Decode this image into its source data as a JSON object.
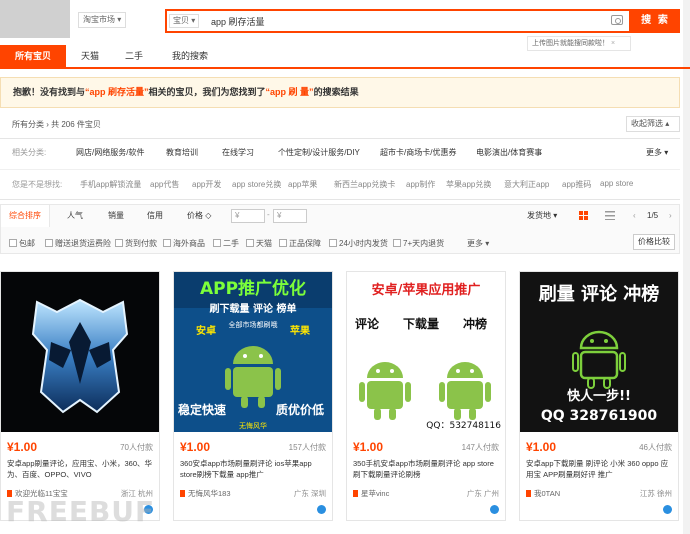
{
  "header": {
    "market_label": "淘宝市场",
    "search_category": "宝贝",
    "search_query": "app 刷存活量",
    "search_button": "搜 索",
    "upload_tip": "上传图片就能搜同款啦！"
  },
  "tabs": [
    {
      "label": "所有宝贝"
    },
    {
      "label": "天猫"
    },
    {
      "label": "二手"
    },
    {
      "label": "我的搜索"
    }
  ],
  "notice": {
    "prefix": "抱歉！没有找到与",
    "query1": "“app 刷存活量”",
    "mid": "相关的宝贝，我们为您找到了",
    "query2": "“app 刷 量”",
    "suffix": "的搜索结果"
  },
  "breadcrumb": {
    "text": "所有分类 › 共 206 件宝贝",
    "filter_toggle": "收起筛选"
  },
  "related_categories": {
    "label": "相关分类:",
    "items": [
      "网店/网络服务/软件",
      "教育培训",
      "在线学习",
      "个性定制/设计服务/DIY",
      "超市卡/商场卡/优惠券",
      "电影演出/体育赛事"
    ],
    "more": "更多"
  },
  "related_search": {
    "label": "您是不是想找:",
    "items": [
      "手机app解锁流量",
      "app代售",
      "app开发",
      "app store兑换",
      "app苹果",
      "新西兰app兑换卡",
      "app制作",
      "苹果app兑换",
      "意大利正app",
      "app推码",
      "app store"
    ]
  },
  "sort": {
    "tabs": [
      "综合排序",
      "人气",
      "销量",
      "信用",
      "价格"
    ],
    "price_from": "¥",
    "price_to": "¥",
    "delivery": "发货地",
    "page": "1/5",
    "checkboxes": [
      "包邮",
      "赠送退货运费险",
      "货到付款",
      "海外商品",
      "二手",
      "天猫",
      "正品保障",
      "24小时内发货",
      "7+天内退货"
    ],
    "more": "更多",
    "compare": "价格比较"
  },
  "products": [
    {
      "price": "¥1.00",
      "sales": "70人付款",
      "title": "安卓app刷量评论，应用宝、小米，360、华为、百度、OPPO、VIVO",
      "shop": "欢迎光临11宝宝",
      "location": "浙江 杭州"
    },
    {
      "price": "¥1.00",
      "sales": "157人付款",
      "title": "360安卓app市场刷量刷评论 ios苹果app store刷榜下载量 app推广",
      "shop": "无悔风华183",
      "location": "广东 深圳"
    },
    {
      "price": "¥1.00",
      "sales": "147人付款",
      "title": "350手机安卓app市场刷量刷评论 app store刷下载刷量评论刷榜",
      "shop": "星苹vinc",
      "location": "广东 广州"
    },
    {
      "price": "¥1.00",
      "sales": "46人付款",
      "title": "安卓app下载刷量 刷评论 小米 360 oppo 应用宝 APP刷量刷好评 推广",
      "shop": "我0TAN",
      "location": "江苏 徐州"
    }
  ],
  "product_images": [
    {
      "kind": "logo"
    },
    {
      "headline": "APP推广优化",
      "sub": "刷下载量 评论 榜单",
      "sub2": "全部市场都刷哦",
      "left_tag": "安卓",
      "right_tag": "苹果",
      "foot_left": "稳定快速",
      "foot_right": "质优价低",
      "foot_small": "无悔风华"
    },
    {
      "headline": "安卓/苹果应用推广",
      "words": [
        "评论",
        "下载量",
        "冲榜"
      ],
      "qq": "QQ：532748116"
    },
    {
      "headline": "刷量 评论 冲榜",
      "line1": "快人一步!!",
      "line2": "QQ 328761900"
    }
  ],
  "watermark": "FREEBUF",
  "colors": {
    "accent": "#ff4400"
  }
}
